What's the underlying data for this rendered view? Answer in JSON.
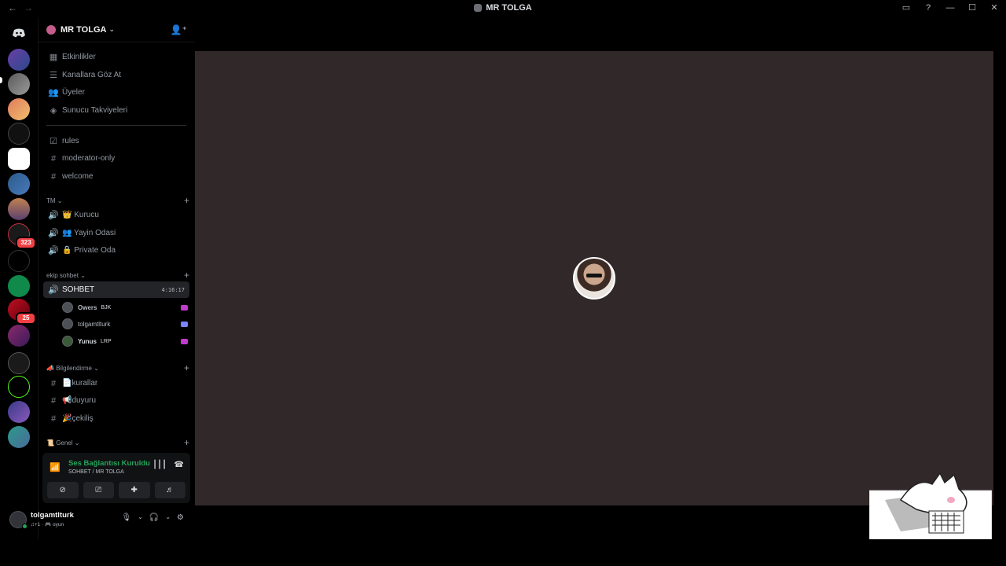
{
  "titlebar": {
    "title": "MR TOLGA",
    "back_icon": "←",
    "forward_icon": "→"
  },
  "server": {
    "name": "MR TOLGA"
  },
  "menu": [
    {
      "label": "Etkinlikler",
      "icon": "calendar-icon"
    },
    {
      "label": "Kanallara Göz At",
      "icon": "browse-icon"
    },
    {
      "label": "Üyeler",
      "icon": "members-icon"
    },
    {
      "label": "Sunucu Takviyeleri",
      "icon": "boost-icon"
    }
  ],
  "channels_top": [
    {
      "label": "rules",
      "icon": "rules-icon"
    },
    {
      "label": "moderator-only",
      "icon": "hash-icon"
    },
    {
      "label": "welcome",
      "icon": "hash-icon"
    }
  ],
  "categories": {
    "tm": "TM",
    "ekip": "ekip sohbet",
    "bilgi": "Bilgilendirme",
    "genel": "Genel"
  },
  "tm_channels": [
    {
      "label": "👑 Kurucu"
    },
    {
      "label": "👥 Yayin Odasi"
    },
    {
      "label": "🔒 Private Oda"
    }
  ],
  "active_channel": {
    "label": "SOHBET",
    "timer": "4:16:17"
  },
  "voice_users": [
    {
      "name": "Owers",
      "tag": "BJK"
    },
    {
      "name": "tolgamtlturk",
      "tag": ""
    },
    {
      "name": "Yunus",
      "tag": "LRP"
    }
  ],
  "bilgi_channels": [
    {
      "label": "📄kurallar"
    },
    {
      "label": "📢duyuru"
    },
    {
      "label": "🎉çekiliş"
    }
  ],
  "rail_badges": {
    "b1": "323",
    "b2": "25"
  },
  "voice": {
    "status": "Ses Bağlantısı Kuruldu",
    "channel": "SOHBET / MR TOLGA"
  },
  "user": {
    "name": "tolgamtlturk",
    "status": "♫+1 · 🎮 oyun"
  },
  "colors": {
    "accent_green": "#23a55a",
    "badge_red": "#f23f43",
    "stage_bg": "#31282a"
  }
}
